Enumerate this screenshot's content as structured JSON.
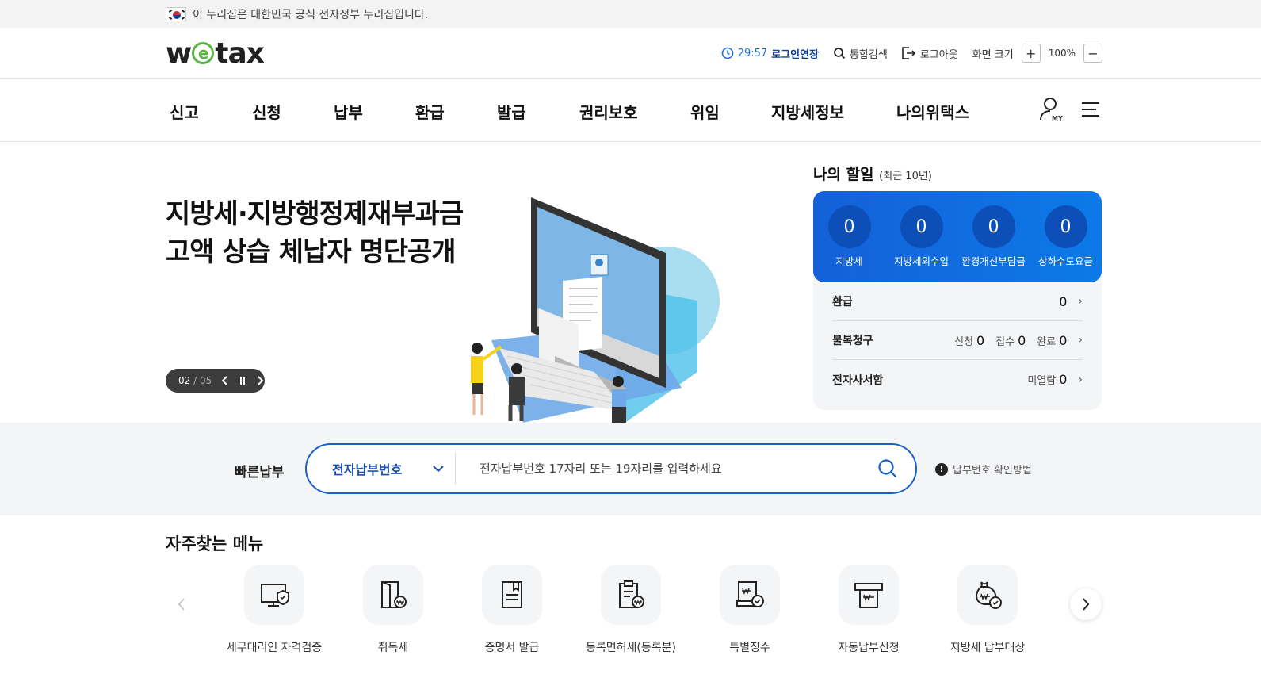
{
  "gov_banner": {
    "text": "이 누리집은 대한민국 공식 전자정부 누리집입니다."
  },
  "header": {
    "logo": {
      "part1": "w",
      "e": "e",
      "part2": "tax"
    },
    "timer": "29:57",
    "extend_login": "로그인연장",
    "search": "통합검색",
    "logout": "로그아웃",
    "zoom_label": "화면 크기",
    "zoom_plus": "+",
    "zoom_value": "100%",
    "zoom_minus": "−"
  },
  "nav": {
    "items": [
      "신고",
      "신청",
      "납부",
      "환급",
      "발급",
      "권리보호",
      "위임",
      "지방세정보",
      "나의위택스"
    ],
    "my_label": "MY"
  },
  "hero": {
    "title_line1": "지방세·지방행정제재부과금",
    "title_line2": "고액 상습 체납자 명단공개",
    "slide_current": "02",
    "slide_sep": "/",
    "slide_total": "05"
  },
  "todo": {
    "title": "나의 할일",
    "subtitle": "(최근 10년)",
    "counters": [
      {
        "value": "0",
        "label": "지방세"
      },
      {
        "value": "0",
        "label": "지방세외수입"
      },
      {
        "value": "0",
        "label": "환경개선부담금"
      },
      {
        "value": "0",
        "label": "상하수도요금"
      }
    ],
    "refund": {
      "label": "환급",
      "value": "0"
    },
    "appeal": {
      "label": "불복청구",
      "apply_label": "신청",
      "apply": "0",
      "receive_label": "접수",
      "receive": "0",
      "done_label": "완료",
      "done": "0"
    },
    "mail": {
      "label": "전자사서함",
      "unread_label": "미열람",
      "unread": "0"
    }
  },
  "quick_pay": {
    "label": "빠른납부",
    "select_value": "전자납부번호",
    "placeholder": "전자납부번호 17자리 또는 19자리를 입력하세요",
    "help": "납부번호 확인방법"
  },
  "frequent": {
    "title": "자주찾는 메뉴",
    "items": [
      {
        "label": "세무대리인 자격검증",
        "icon": "monitor-shield-icon"
      },
      {
        "label": "취득세",
        "icon": "door-won-icon"
      },
      {
        "label": "증명서 발급",
        "icon": "document-bookmark-icon"
      },
      {
        "label": "등록면허세(등록분)",
        "icon": "clipboard-won-icon"
      },
      {
        "label": "특별징수",
        "icon": "receipt-check-icon"
      },
      {
        "label": "자동납부신청",
        "icon": "atm-card-icon"
      },
      {
        "label": "지방세 납부대상",
        "icon": "money-bag-check-icon"
      }
    ]
  },
  "colors": {
    "primary": "#1a5fc7",
    "accent_green": "#5ab645",
    "todo_blue": "#0b7ae8"
  }
}
